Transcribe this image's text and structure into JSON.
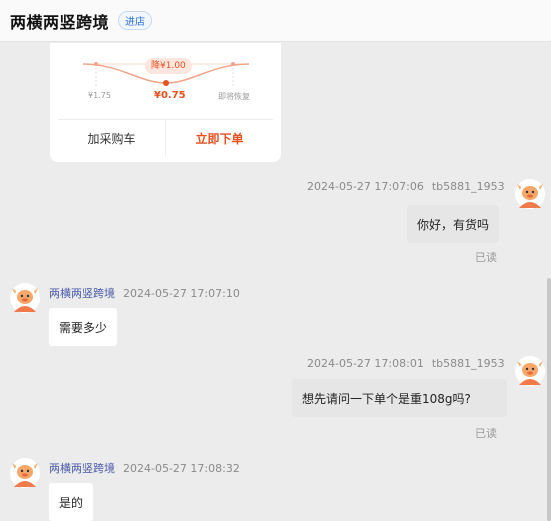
{
  "header": {
    "shop_name": "两横两竖跨境",
    "enter_shop": "进店"
  },
  "product_card": {
    "price_drop_tag": "降¥1.00",
    "original_price": "¥1.75",
    "current_price": "¥0.75",
    "restore_label": "即将恢复",
    "add_to_cart": "加采购车",
    "buy_now": "立即下单"
  },
  "messages": [
    {
      "from": "me",
      "sender": "tb5881_1953",
      "time": "2024-05-27 17:07:06",
      "text": "你好，有货吗",
      "status": "已读"
    },
    {
      "from": "shop",
      "sender": "两横两竖跨境",
      "time": "2024-05-27 17:07:10",
      "text": "需要多少"
    },
    {
      "from": "me",
      "sender": "tb5881_1953",
      "time": "2024-05-27 17:08:01",
      "text": "想先请问一下单个是重108g吗?",
      "status": "已读"
    },
    {
      "from": "shop",
      "sender": "两横两竖跨境",
      "time": "2024-05-27 17:08:32",
      "text": "是的"
    }
  ],
  "colors": {
    "accent": "#e8501e",
    "link": "#2a6fdb",
    "avatar": "#f07a4a"
  }
}
